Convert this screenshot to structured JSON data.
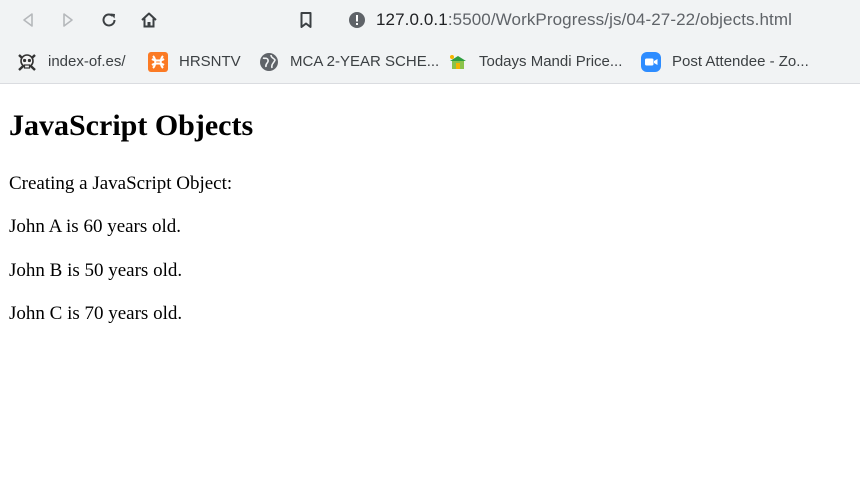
{
  "browser": {
    "address_host": "127.0.0.1",
    "address_rest": ":5500/WorkProgress/js/04-27-22/objects.html"
  },
  "bookmarks": [
    {
      "label": "index-of.es/",
      "icon": "skull-icon"
    },
    {
      "label": "HRSNTV",
      "icon": "xampp-icon"
    },
    {
      "label": "MCA 2-YEAR SCHE...",
      "icon": "globe-icon"
    },
    {
      "label": "Todays Mandi Price...",
      "icon": "mandi-icon"
    },
    {
      "label": "Post Attendee - Zo...",
      "icon": "zoom-icon"
    }
  ],
  "page": {
    "heading": "JavaScript Objects",
    "lines": [
      "Creating a JavaScript Object:",
      "John A is 60 years old.",
      "John B is 50 years old.",
      "John C is 70 years old."
    ]
  }
}
